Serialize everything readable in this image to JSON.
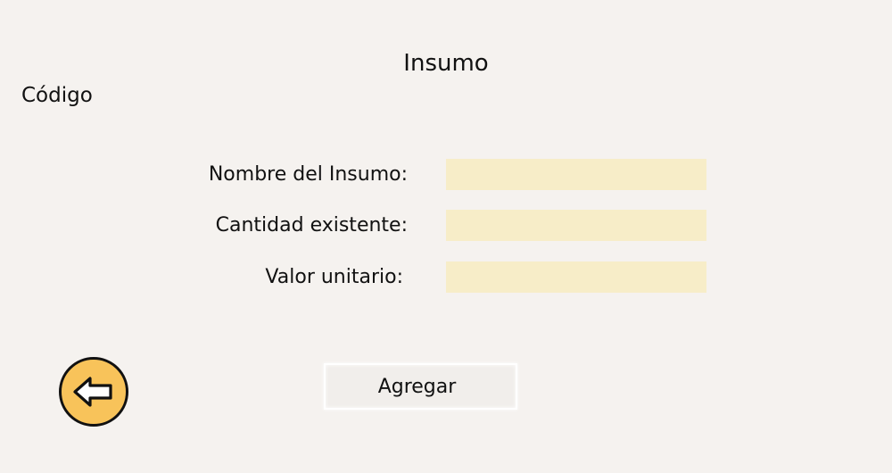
{
  "page": {
    "title": "Insumo",
    "code_label": "Código"
  },
  "form": {
    "fields": [
      {
        "label": "Nombre del Insumo:",
        "value": "",
        "placeholder": ""
      },
      {
        "label": "Cantidad existente:",
        "value": "",
        "placeholder": ""
      },
      {
        "label": "Valor unitario:",
        "value": "",
        "placeholder": ""
      }
    ]
  },
  "actions": {
    "add_label": "Agregar",
    "back_icon": "arrow-left-icon"
  },
  "colors": {
    "background": "#f5f2ef",
    "input_background": "#f7edc8",
    "back_button_background": "#f8c35a",
    "text": "#111111"
  }
}
